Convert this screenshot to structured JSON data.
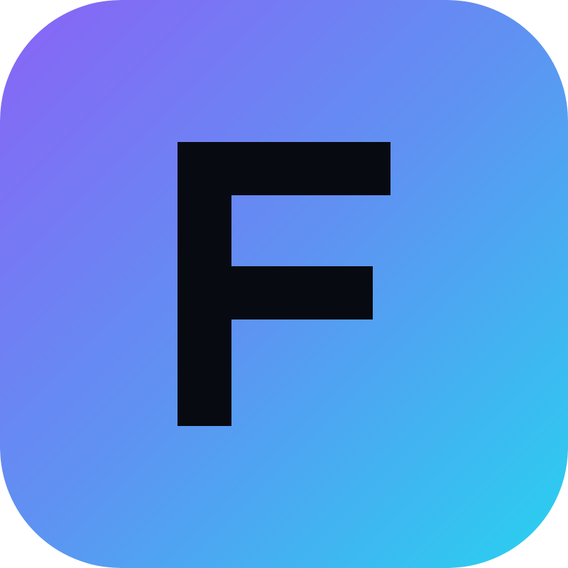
{
  "icon": {
    "letter": "F",
    "letter_color": "#080A12",
    "gradient": {
      "start": "#8A63F6",
      "mid": "#5E93F2",
      "end": "#27D2F0"
    }
  }
}
